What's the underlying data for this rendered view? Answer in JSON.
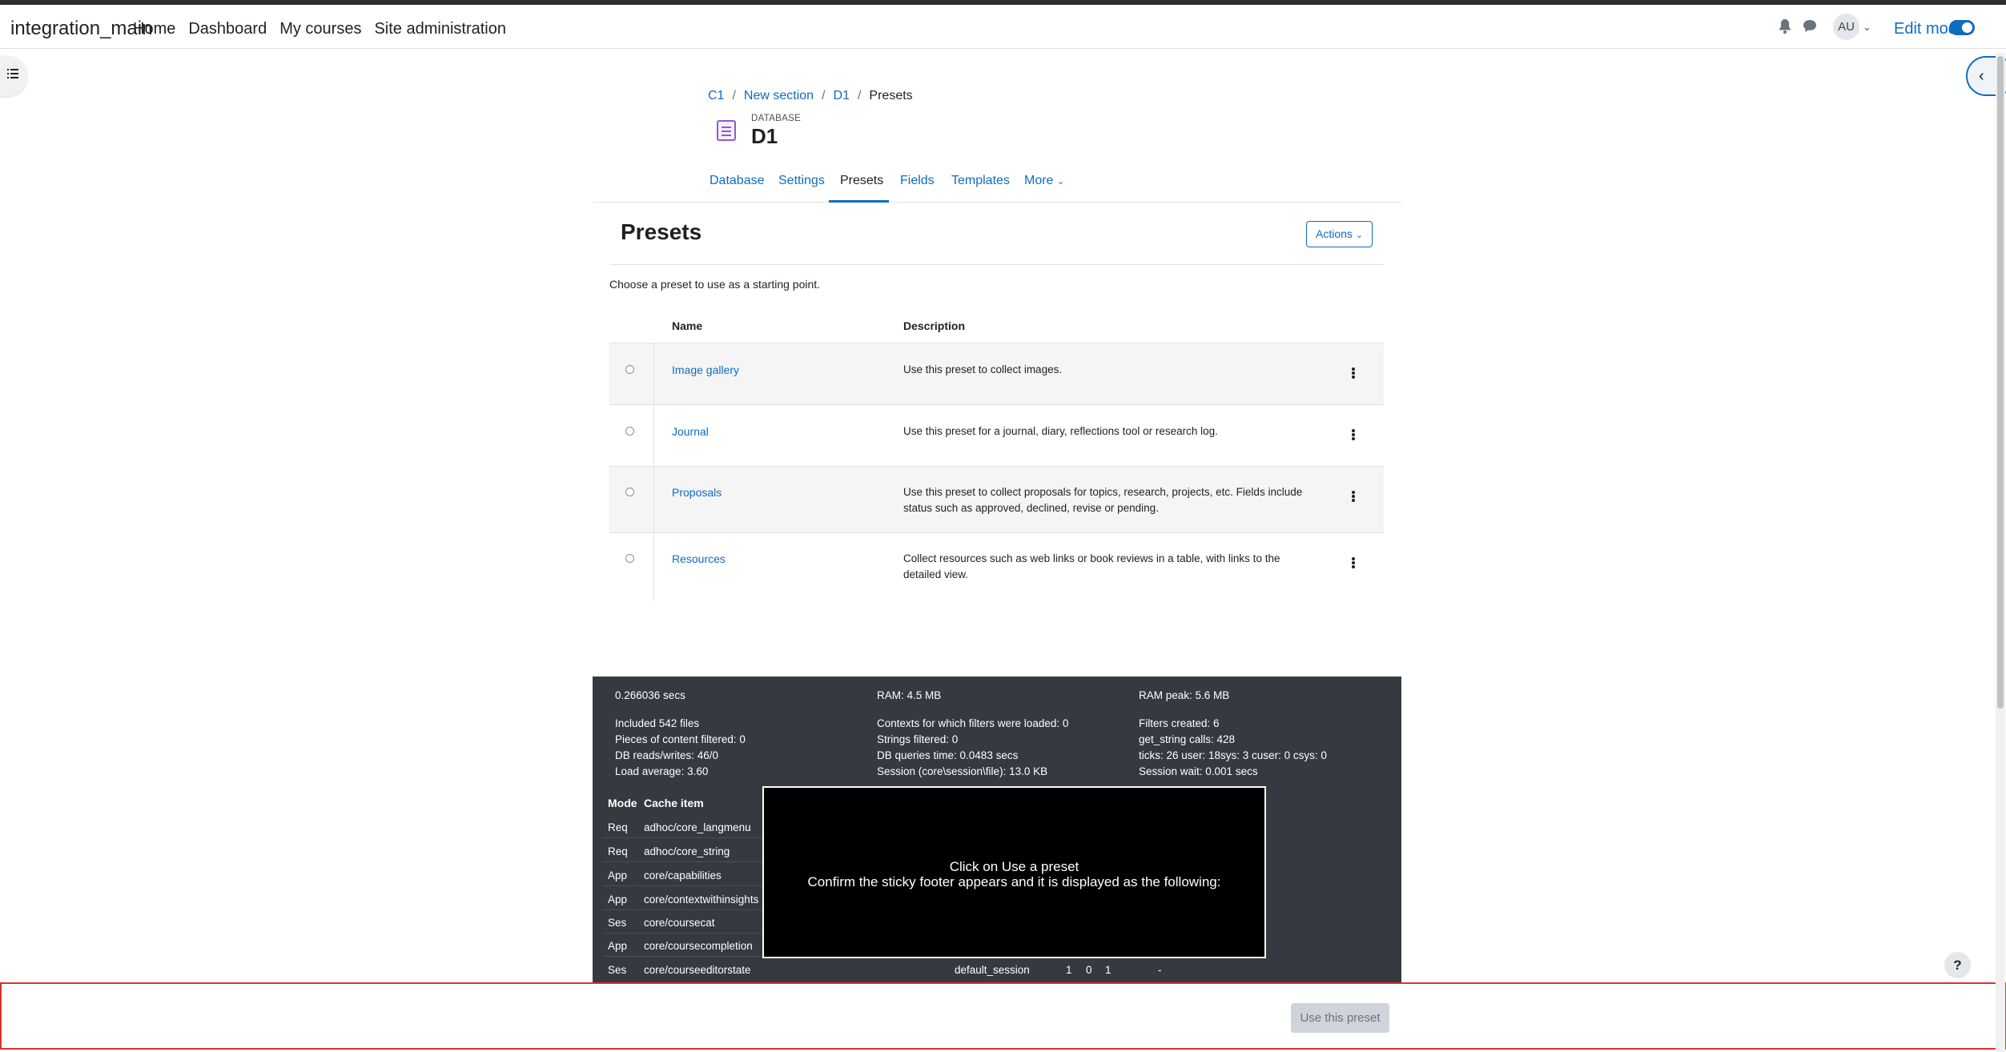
{
  "navbar": {
    "brand": "integration_main",
    "links": [
      "Home",
      "Dashboard",
      "My courses",
      "Site administration"
    ],
    "avatar_initials": "AU",
    "edit_mode_label": "Edit mode",
    "edit_mode_on": true
  },
  "breadcrumb": [
    "C1",
    "New section",
    "D1",
    "Presets"
  ],
  "module": {
    "type_label": "DATABASE",
    "title": "D1"
  },
  "tabs": [
    {
      "label": "Database",
      "active": false
    },
    {
      "label": "Settings",
      "active": false
    },
    {
      "label": "Presets",
      "active": true
    },
    {
      "label": "Fields",
      "active": false
    },
    {
      "label": "Templates",
      "active": false
    },
    {
      "label": "More",
      "active": false
    }
  ],
  "page": {
    "heading": "Presets",
    "actions_label": "Actions",
    "intro": "Choose a preset to use as a starting point."
  },
  "table": {
    "headers": [
      "Name",
      "Description"
    ],
    "rows": [
      {
        "name": "Image gallery",
        "description": "Use this preset to collect images."
      },
      {
        "name": "Journal",
        "description": "Use this preset for a journal, diary, reflections tool or research log."
      },
      {
        "name": "Proposals",
        "description": "Use this preset to collect proposals for topics, research, projects, etc. Fields include status such as approved, declined, revise or pending."
      },
      {
        "name": "Resources",
        "description": "Collect resources such as web links or book reviews in a table, with links to the detailed view."
      }
    ]
  },
  "perf": {
    "col1": [
      "0.266036 secs",
      "Included 542 files",
      "Pieces of content filtered: 0",
      "DB reads/writes: 46/0",
      "Load average: 3.60"
    ],
    "col2": [
      "RAM: 4.5 MB",
      "Contexts for which filters were loaded: 0",
      "Strings filtered: 0",
      "DB queries time: 0.0483 secs",
      "Session (core\\session\\file): 13.0 KB"
    ],
    "col3": [
      "RAM peak: 5.6 MB",
      "Filters created: 6",
      "get_string calls: 428",
      "ticks: 26 user: 18sys: 3 cuser: 0 csys: 0",
      "Session wait: 0.001 secs"
    ],
    "cache_headers": [
      "Mode",
      "Cache item"
    ],
    "cache_rows": [
      {
        "mode": "Req",
        "item": "adhoc/core_langmenu"
      },
      {
        "mode": "Req",
        "item": "adhoc/core_string"
      },
      {
        "mode": "App",
        "item": "core/capabilities"
      },
      {
        "mode": "App",
        "item": "core/contextwithinsights"
      },
      {
        "mode": "Ses",
        "item": "core/coursecat"
      },
      {
        "mode": "App",
        "item": "core/coursecompletion"
      },
      {
        "mode": "Ses",
        "item": "core/courseeditorstate"
      }
    ],
    "last_row_extra": {
      "store": "default_session",
      "a": "1",
      "b": "0",
      "c": "1",
      "d": "-"
    }
  },
  "overlay": {
    "line1": "Click on Use a preset",
    "line2": "Confirm the sticky footer appears and it is displayed as the following:"
  },
  "help_label": "?",
  "footer": {
    "use_button": "Use this preset"
  }
}
